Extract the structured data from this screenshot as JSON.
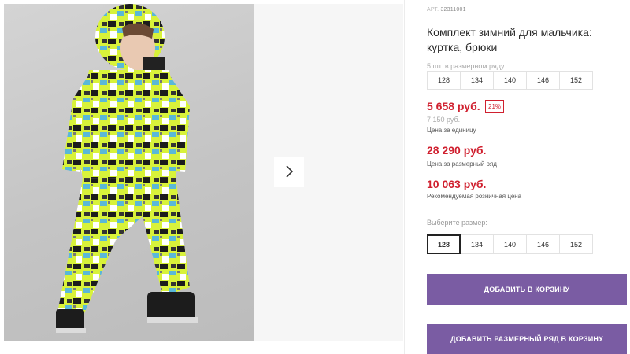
{
  "product": {
    "article_label": "АРТ.",
    "article_number": "32311001",
    "title": "Комплект зимний для мальчика: куртка, брюки"
  },
  "gallery": {
    "photo_subject": "boy in printed winter suit",
    "next_icon": "chevron-right-icon"
  },
  "series": {
    "label": "5 шт. в размерном ряду",
    "sizes": [
      "128",
      "134",
      "140",
      "146",
      "152"
    ]
  },
  "prices": {
    "unit_price": "5 658 руб.",
    "discount": "21%",
    "old_price": "7 150 руб.",
    "unit_caption": "Цена за единицу",
    "series_price": "28 290 руб.",
    "series_caption": "Цена за размерный ряд",
    "rrp_price": "10 063 руб.",
    "rrp_caption": "Рекомендуемая розничная цена"
  },
  "size_select": {
    "label": "Выберите размер:",
    "sizes": [
      "128",
      "134",
      "140",
      "146",
      "152"
    ],
    "selected": "128"
  },
  "buttons": {
    "add_to_cart": "ДОБАВИТЬ В КОРЗИНУ",
    "add_series_to_cart": "ДОБАВИТЬ РАЗМЕРНЫЙ РЯД В КОРЗИНУ"
  },
  "colors": {
    "accent": "#7a5ca3",
    "price_red": "#d0202f",
    "suit_yellow": "#d8f23a"
  }
}
